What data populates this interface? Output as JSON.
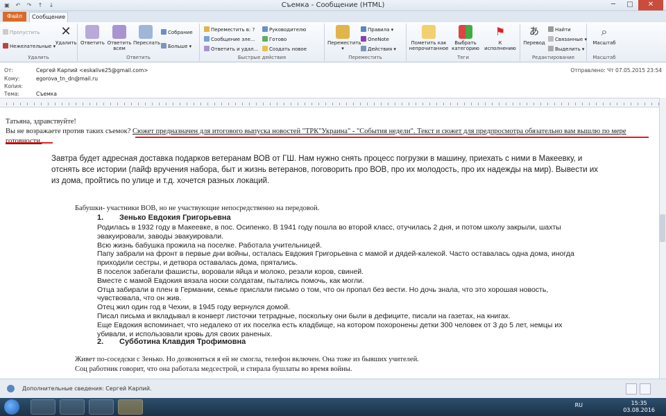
{
  "window": {
    "title": "Съемка  -  Сообщение (HTML)",
    "min": "─",
    "max": "□",
    "close": "✕"
  },
  "tabs": [
    "Файл",
    "Сообщение"
  ],
  "ribbon": {
    "groups": {
      "delete": "Удалить",
      "respond": "Ответить",
      "quick": "Быстрые действия",
      "move": "Переместить",
      "tags": "Теги",
      "editing": "Редактирование",
      "zoom": "Масштаб"
    },
    "ignore": "Пропустить",
    "junk": "Нежелательные",
    "delete": "Удалить",
    "reply": "Ответить",
    "reply_all": "Ответить всем",
    "forward": "Переслать",
    "meeting": "Собрание",
    "more": "Больше",
    "qs": [
      "Переместить в: ?",
      "Сообщение эле...",
      "Ответить и удал...",
      "Руководителю",
      "Готово",
      "Создать новое"
    ],
    "move": "Переместить",
    "rules": "Правила",
    "onenote": "OneNote",
    "actions": "Действия",
    "mark_unread": "Пометить как непрочитанное",
    "categorize": "Выбрать категорию",
    "followup": "К исполнению",
    "translate": "Перевод",
    "find": "Найти",
    "related": "Связанные",
    "select": "Выделить",
    "zoom": "Масштаб"
  },
  "header": {
    "from_label": "От:",
    "from": "Сергей Карпий <eskalive25@gmail.com>",
    "to_label": "Кому:",
    "to": "egorova_tn_dn@mail.ru",
    "cc_label": "Копия:",
    "cc": "",
    "subject_label": "Тема:",
    "subject": "Съемка",
    "sent": "Отправлено:  Чт 07.05.2015 23:54"
  },
  "body": {
    "greeting": "Татьяна, здравствуйте!",
    "question_a": "Вы не возражаете против таких съемок? ",
    "question_b": "Сюжет предназначен для итогового выпуска новостей \"ТРК\"Украина\"  - \"События недели\". Текст и сюжет для предпросмотра обязательно вам вышлю по мере готовности.",
    "p1": "Завтра будет адресная доставка подарков ветеранам ВОВ от ГШ. Нам нужно снять процесс погрузки в машину, приехать с ними в Макеевку, и отснять все истории (лайф вручения набора, быт и жизнь ветеранов, поговорить про ВОВ, про их молодость, про их надежды на мир). Вывести их из дома, пройтись по улице и т.д. хочется разных локаций.",
    "p2": "Бабушки- участники ВОВ, но не участвующие непосредственно на  передовой.",
    "item1_num": "1.",
    "item1": "Зенько Евдокия Григорьевна",
    "story": [
      "Родилась в 1932 году в Макеевке, в пос. Осипенко. В 1941 году пошла во второй класс, отучилась 2 дня, и потом школу закрыли, шахты эвакуировали, заводы эвакуировали.",
      "Всю жизнь бабушка прожила на поселке. Работала учительницей.",
      "Папу забрали на фронт в первые дни войны, осталась Евдокия Григорьевна с мамой и дядей-калекой. Часто оставалась одна дома, иногда приходили сестры, и детвора оставалась дома, прятались.",
      "В поселок забегали фашисты, воровали яйца и молоко, резали коров, свиней.",
      "Вместе с мамой Евдокия вязала носки солдатам, пытались помочь, как могли.",
      "Отца забирали в плен в Германии, семье прислали письмо о том, что он пропал без вести. Но дочь знала, что это хорошая новость, чувствовала, что он жив.",
      "Отец жил один год в Чехии, в 1945 году вернулся домой.",
      "Писал письма и вкладывал в конверт листочки тетрадные, поскольку они были в дефиците, писали на газетах, на книгах.",
      "Еще Евдокия вспоминает, что недалеко от их поселка есть кладбище, на котором похоронены детки 300 человек от 3 до 5 лет, немцы их убивали, и использовали кровь для своих раненых."
    ],
    "item2_num": "2.",
    "item2": "Субботина Клавдия Трофимовна",
    "p4a": "Живет по-соседски с Зенько. Но дозвониться я ей не смогла, телефон включен. Она тоже из бывших учителей.",
    "p4b": "Соц работник говорит, что она работала медсестрой, и стирала бушлаты во время войны."
  },
  "status": "Дополнительные сведения: Сергей Карпий.",
  "taskbar": {
    "lang": "RU",
    "time": "15:35",
    "date": "03.08.2016"
  },
  "colors": {
    "underline": "#e02020",
    "file_tab": "#d86b2a"
  }
}
